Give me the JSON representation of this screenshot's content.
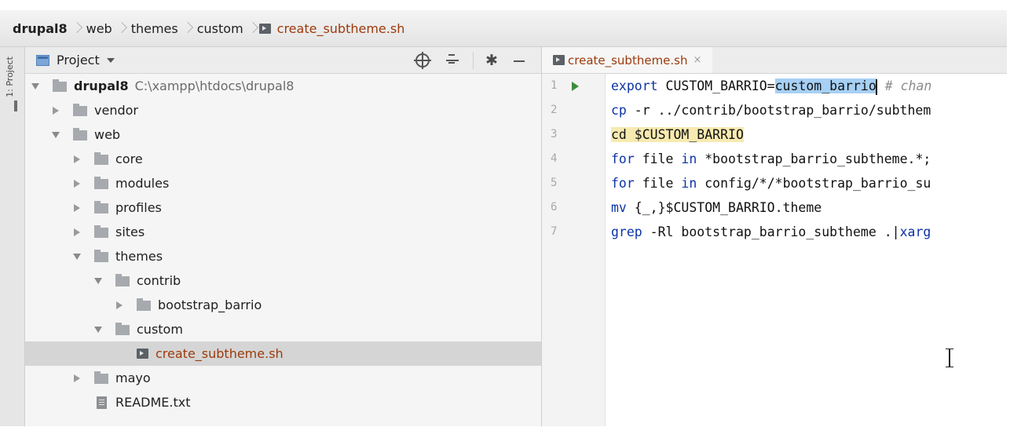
{
  "breadcrumb": [
    "drupal8",
    "web",
    "themes",
    "custom"
  ],
  "breadcrumb_file": "create_subtheme.sh",
  "side_tab_label": "1: Project",
  "project_panel": {
    "title": "Project"
  },
  "tree": [
    {
      "label": "drupal8",
      "path": "C:\\xampp\\htdocs\\drupal8",
      "depth": 0,
      "state": "open",
      "kind": "folder",
      "bold": true
    },
    {
      "label": "vendor",
      "depth": 1,
      "state": "closed",
      "kind": "folder"
    },
    {
      "label": "web",
      "depth": 1,
      "state": "open",
      "kind": "folder"
    },
    {
      "label": "core",
      "depth": 2,
      "state": "closed",
      "kind": "folder"
    },
    {
      "label": "modules",
      "depth": 2,
      "state": "closed",
      "kind": "folder"
    },
    {
      "label": "profiles",
      "depth": 2,
      "state": "closed",
      "kind": "folder"
    },
    {
      "label": "sites",
      "depth": 2,
      "state": "closed",
      "kind": "folder"
    },
    {
      "label": "themes",
      "depth": 2,
      "state": "open",
      "kind": "folder"
    },
    {
      "label": "contrib",
      "depth": 3,
      "state": "open",
      "kind": "folder"
    },
    {
      "label": "bootstrap_barrio",
      "depth": 4,
      "state": "closed",
      "kind": "folder"
    },
    {
      "label": "custom",
      "depth": 3,
      "state": "open",
      "kind": "folder"
    },
    {
      "label": "create_subtheme.sh",
      "depth": 4,
      "state": "none",
      "kind": "sh",
      "selected": true
    },
    {
      "label": "mayo",
      "depth": 2,
      "state": "closed",
      "kind": "folder"
    },
    {
      "label": "README.txt",
      "depth": 2,
      "state": "none",
      "kind": "txt"
    }
  ],
  "editor": {
    "tab_label": "create_subtheme.sh",
    "tab_close": "×",
    "lines": [
      [
        {
          "t": "export",
          "c": "kw"
        },
        {
          "t": " CUSTOM_BARRIO="
        },
        {
          "t": "custom_barrio",
          "c": "sel"
        },
        {
          "t": "",
          "c": "caret"
        },
        {
          "t": " "
        },
        {
          "t": "# chan",
          "c": "cm"
        }
      ],
      [
        {
          "t": "cp",
          "c": "kw"
        },
        {
          "t": " -r ../contrib/bootstrap_barrio/subthem"
        }
      ],
      [
        {
          "t": "cd $CUSTOM_BARRIO",
          "c": "hl"
        }
      ],
      [
        {
          "t": "for",
          "c": "kw"
        },
        {
          "t": " file "
        },
        {
          "t": "in",
          "c": "kw"
        },
        {
          "t": " *bootstrap_barrio_subtheme.*;"
        }
      ],
      [
        {
          "t": "for",
          "c": "kw"
        },
        {
          "t": " file "
        },
        {
          "t": "in",
          "c": "kw"
        },
        {
          "t": " config/*/*bootstrap_barrio_su"
        }
      ],
      [
        {
          "t": "mv",
          "c": "kw"
        },
        {
          "t": " {_,}$CUSTOM_BARRIO.theme"
        }
      ],
      [
        {
          "t": "grep",
          "c": "kw"
        },
        {
          "t": " -Rl bootstrap_barrio_subtheme .|"
        },
        {
          "t": "xarg",
          "c": "kw"
        }
      ]
    ]
  }
}
